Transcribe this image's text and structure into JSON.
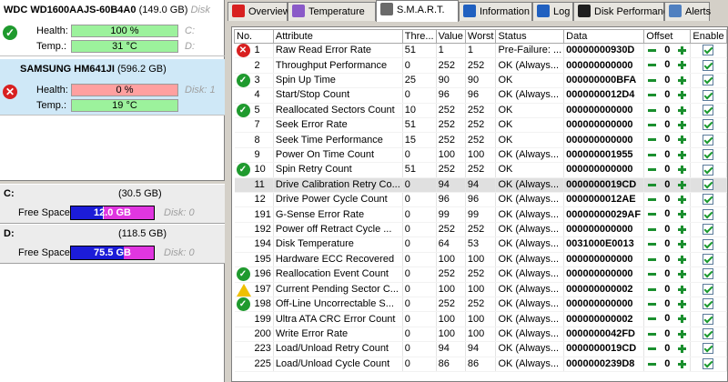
{
  "disks": [
    {
      "model": "WDC WD1600AAJS-60B4A0",
      "size": "(149.0 GB)",
      "disk_label": "Disk",
      "health_label": "Health:",
      "health_value": "100 %",
      "temp_label": "Temp.:",
      "temp_value": "31 °C",
      "drive1": "C:",
      "drive2": "D:",
      "status": "ok"
    },
    {
      "model": "SAMSUNG HM641JI",
      "size": "(596.2 GB)",
      "health_label": "Health:",
      "health_value": "0 %",
      "temp_label": "Temp.:",
      "temp_value": "19 °C",
      "drive1": "Disk: 1",
      "status": "bad"
    }
  ],
  "partitions": [
    {
      "name": "C:",
      "size": "(30.5 GB)",
      "free_label": "Free Space",
      "free_value": "12.0 GB",
      "free_fraction": 0.39,
      "disk": "Disk: 0"
    },
    {
      "name": "D:",
      "size": "(118.5 GB)",
      "free_label": "Free Space",
      "free_value": "75.5 GB",
      "free_fraction": 0.64,
      "disk": "Disk: 0"
    }
  ],
  "tabs": [
    {
      "label": "Overview",
      "icon": "overview-icon",
      "color": "#d82020"
    },
    {
      "label": "Temperature",
      "icon": "temperature-icon",
      "color": "#8a5ac8"
    },
    {
      "label": "S.M.A.R.T.",
      "icon": "smart-icon",
      "color": "#6a6a6a",
      "active": true
    },
    {
      "label": "Information",
      "icon": "information-icon",
      "color": "#2060c0"
    },
    {
      "label": "Log",
      "icon": "log-icon",
      "color": "#2060c0"
    },
    {
      "label": "Disk Performance",
      "icon": "disk-performance-icon",
      "color": "#1f1f1f"
    },
    {
      "label": "Alerts",
      "icon": "alerts-icon",
      "color": "#5080c0"
    }
  ],
  "columns": [
    "No.",
    "Attribute",
    "Thre...",
    "Value",
    "Worst",
    "Status",
    "Data",
    "Offset",
    "Enable"
  ],
  "rows": [
    {
      "no": "1",
      "attr": "Raw Read Error Rate",
      "thr": "51",
      "val": "1",
      "worst": "1",
      "status": "Pre-Failure: ...",
      "data": "00000000930D",
      "icon": "bad"
    },
    {
      "no": "2",
      "attr": "Throughput Performance",
      "thr": "0",
      "val": "252",
      "worst": "252",
      "status": "OK (Always...",
      "data": "000000000000",
      "icon": ""
    },
    {
      "no": "3",
      "attr": "Spin Up Time",
      "thr": "25",
      "val": "90",
      "worst": "90",
      "status": "OK",
      "data": "000000000BFA",
      "icon": "ok"
    },
    {
      "no": "4",
      "attr": "Start/Stop Count",
      "thr": "0",
      "val": "96",
      "worst": "96",
      "status": "OK (Always...",
      "data": "0000000012D4",
      "icon": ""
    },
    {
      "no": "5",
      "attr": "Reallocated Sectors Count",
      "thr": "10",
      "val": "252",
      "worst": "252",
      "status": "OK",
      "data": "000000000000",
      "icon": "ok"
    },
    {
      "no": "7",
      "attr": "Seek Error Rate",
      "thr": "51",
      "val": "252",
      "worst": "252",
      "status": "OK",
      "data": "000000000000",
      "icon": ""
    },
    {
      "no": "8",
      "attr": "Seek Time Performance",
      "thr": "15",
      "val": "252",
      "worst": "252",
      "status": "OK",
      "data": "000000000000",
      "icon": ""
    },
    {
      "no": "9",
      "attr": "Power On Time Count",
      "thr": "0",
      "val": "100",
      "worst": "100",
      "status": "OK (Always...",
      "data": "000000001955",
      "icon": ""
    },
    {
      "no": "10",
      "attr": "Spin Retry Count",
      "thr": "51",
      "val": "252",
      "worst": "252",
      "status": "OK",
      "data": "000000000000",
      "icon": "ok"
    },
    {
      "no": "11",
      "attr": "Drive Calibration Retry Co...",
      "thr": "0",
      "val": "94",
      "worst": "94",
      "status": "OK (Always...",
      "data": "0000000019CD",
      "icon": "",
      "hl": true
    },
    {
      "no": "12",
      "attr": "Drive Power Cycle Count",
      "thr": "0",
      "val": "96",
      "worst": "96",
      "status": "OK (Always...",
      "data": "0000000012AE",
      "icon": ""
    },
    {
      "no": "191",
      "attr": "G-Sense Error Rate",
      "thr": "0",
      "val": "99",
      "worst": "99",
      "status": "OK (Always...",
      "data": "00000000029AF",
      "icon": ""
    },
    {
      "no": "192",
      "attr": "Power off Retract Cycle ...",
      "thr": "0",
      "val": "252",
      "worst": "252",
      "status": "OK (Always...",
      "data": "000000000000",
      "icon": ""
    },
    {
      "no": "194",
      "attr": "Disk Temperature",
      "thr": "0",
      "val": "64",
      "worst": "53",
      "status": "OK (Always...",
      "data": "0031000E0013",
      "icon": ""
    },
    {
      "no": "195",
      "attr": "Hardware ECC Recovered",
      "thr": "0",
      "val": "100",
      "worst": "100",
      "status": "OK (Always...",
      "data": "000000000000",
      "icon": ""
    },
    {
      "no": "196",
      "attr": "Reallocation Event Count",
      "thr": "0",
      "val": "252",
      "worst": "252",
      "status": "OK (Always...",
      "data": "000000000000",
      "icon": "ok"
    },
    {
      "no": "197",
      "attr": "Current Pending Sector C...",
      "thr": "0",
      "val": "100",
      "worst": "100",
      "status": "OK (Always...",
      "data": "000000000002",
      "icon": "warn"
    },
    {
      "no": "198",
      "attr": "Off-Line Uncorrectable S...",
      "thr": "0",
      "val": "252",
      "worst": "252",
      "status": "OK (Always...",
      "data": "000000000000",
      "icon": "ok"
    },
    {
      "no": "199",
      "attr": "Ultra ATA CRC Error Count",
      "thr": "0",
      "val": "100",
      "worst": "100",
      "status": "OK (Always...",
      "data": "000000000002",
      "icon": ""
    },
    {
      "no": "200",
      "attr": "Write Error Rate",
      "thr": "0",
      "val": "100",
      "worst": "100",
      "status": "OK (Always...",
      "data": "0000000042FD",
      "icon": ""
    },
    {
      "no": "223",
      "attr": "Load/Unload Retry Count",
      "thr": "0",
      "val": "94",
      "worst": "94",
      "status": "OK (Always...",
      "data": "0000000019CD",
      "icon": ""
    },
    {
      "no": "225",
      "attr": "Load/Unload Cycle Count",
      "thr": "0",
      "val": "86",
      "worst": "86",
      "status": "OK (Always...",
      "data": "0000000239D8",
      "icon": ""
    }
  ],
  "offset_value": "0"
}
